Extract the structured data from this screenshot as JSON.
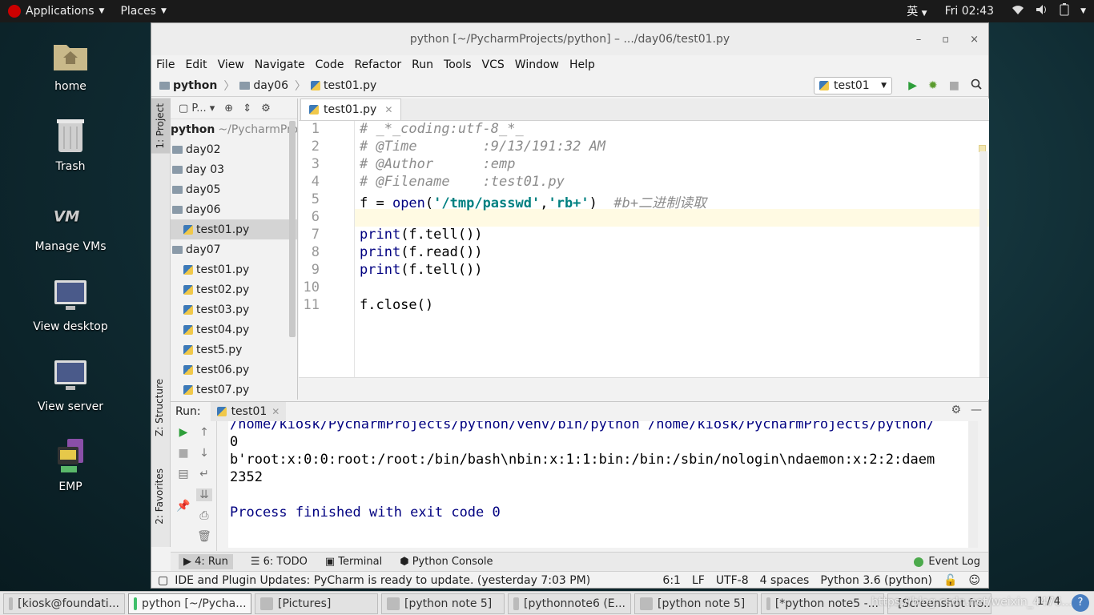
{
  "topbar": {
    "applications": "Applications",
    "places": "Places",
    "ime": "英",
    "clock": "Fri 02:43"
  },
  "desktop": {
    "icons": [
      {
        "label": "home",
        "icon": "home-folder-icon"
      },
      {
        "label": "Trash",
        "icon": "trash-icon"
      },
      {
        "label": "Manage VMs",
        "icon": "vm-icon"
      },
      {
        "label": "View desktop",
        "icon": "monitor-icon"
      },
      {
        "label": "View server",
        "icon": "monitor-icon"
      },
      {
        "label": "EMP",
        "icon": "emp-icon"
      }
    ]
  },
  "window": {
    "title": "python [~/PycharmProjects/python] – .../day06/test01.py",
    "minimize": "–",
    "maximize": "▫",
    "close": "×"
  },
  "menu": [
    "File",
    "Edit",
    "View",
    "Navigate",
    "Code",
    "Refactor",
    "Run",
    "Tools",
    "VCS",
    "Window",
    "Help"
  ],
  "breadcrumb": {
    "root": "python",
    "folder": "day06",
    "file": "test01.py"
  },
  "run_config": {
    "name": "test01"
  },
  "project": {
    "root": "python",
    "root_path": "~/PycharmProjec",
    "tree": [
      {
        "label": "day02",
        "indent": 0,
        "type": "folder"
      },
      {
        "label": "day 03",
        "indent": 0,
        "type": "folder"
      },
      {
        "label": "day05",
        "indent": 0,
        "type": "folder"
      },
      {
        "label": "day06",
        "indent": 0,
        "type": "folder"
      },
      {
        "label": "test01.py",
        "indent": 1,
        "type": "file",
        "selected": true
      },
      {
        "label": "day07",
        "indent": 0,
        "type": "folder"
      },
      {
        "label": "test01.py",
        "indent": 1,
        "type": "file"
      },
      {
        "label": "test02.py",
        "indent": 1,
        "type": "file"
      },
      {
        "label": "test03.py",
        "indent": 1,
        "type": "file"
      },
      {
        "label": "test04.py",
        "indent": 1,
        "type": "file"
      },
      {
        "label": "test5.py",
        "indent": 1,
        "type": "file"
      },
      {
        "label": "test06.py",
        "indent": 1,
        "type": "file"
      },
      {
        "label": "test07.py",
        "indent": 1,
        "type": "file"
      }
    ]
  },
  "side_tabs": {
    "project": "1: Project",
    "structure": "Z: Structure",
    "favorites": "2: Favorites"
  },
  "editor": {
    "tab": "test01.py",
    "line_numbers": [
      "1",
      "2",
      "3",
      "4",
      "5",
      "6",
      "7",
      "8",
      "9",
      "10",
      "11"
    ],
    "lines": {
      "l1": "# _*_coding:utf-8_*_",
      "l2": "# @Time        :9/13/191:32 AM",
      "l3": "# @Author      :emp",
      "l4": "# @Filename    :test01.py",
      "l5_a": "f = ",
      "l5_b": "open",
      "l5_c": "(",
      "l5_d": "'/tmp/passwd'",
      "l5_e": ",",
      "l5_f": "'rb+'",
      "l5_g": ")  ",
      "l5_h": "#b+二进制读取",
      "l7_a": "print",
      "l7_b": "(f.tell())",
      "l8_a": "print",
      "l8_b": "(f.read())",
      "l9_a": "print",
      "l9_b": "(f.tell())",
      "l11": "f.close()"
    }
  },
  "run": {
    "label": "Run:",
    "tab": "test01",
    "output": [
      "/home/kiosk/PycharmProjects/python/venv/bin/python /home/kiosk/PycharmProjects/python/",
      "0",
      "b'root:x:0:0:root:/root:/bin/bash\\nbin:x:1:1:bin:/bin:/sbin/nologin\\ndaemon:x:2:2:daem",
      "2352",
      "",
      "Process finished with exit code 0"
    ]
  },
  "tool_windows": {
    "run": "4: Run",
    "todo": "6: TODO",
    "terminal": "Terminal",
    "console": "Python Console",
    "event_log": "Event Log"
  },
  "status": {
    "message": "IDE and Plugin Updates: PyCharm is ready to update. (yesterday 7:03 PM)",
    "position": "6:1",
    "line_sep": "LF",
    "encoding": "UTF-8",
    "indent": "4 spaces",
    "interpreter": "Python 3.6 (python)"
  },
  "taskbar": {
    "items": [
      "[kiosk@foundati...",
      "python [~/Pycha...",
      "[Pictures]",
      "[python note 5]",
      "[pythonnote6 (E...",
      "[python note 5]",
      "[*python note5 -...",
      "[Screenshot fro..."
    ],
    "watermark": "https://blog.csdn.net/weixin_4476...",
    "pager": "1 / 4"
  }
}
